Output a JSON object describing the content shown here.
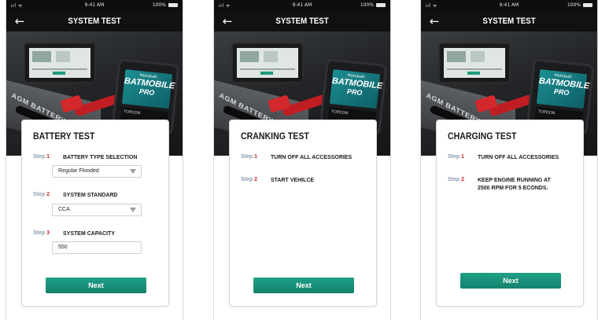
{
  "status_bar": {
    "signal": "ııl ᯤ",
    "time": "9:41 AM",
    "battery": "100%"
  },
  "nav": {
    "title": "SYSTEM TEST",
    "back_icon": "arrow-left-icon"
  },
  "hero": {
    "battery_label": "AGM BATTERY",
    "tester_brand": "Motobatt",
    "tester_model": "BATMOBILE",
    "tester_sub": "PRO",
    "tester_code": "TOPDON"
  },
  "screens": [
    {
      "card_title": "BATTERY TEST",
      "steps": [
        {
          "label": "Step",
          "num": "1",
          "text": "BATTERY TYPE SELECTION",
          "field": "Regular Flooded",
          "has_dropdown": true
        },
        {
          "label": "Step",
          "num": "2",
          "text": "SYSTEM STANDARD",
          "field": "CCA",
          "has_dropdown": true
        },
        {
          "label": "Step",
          "num": "3",
          "text": "SYSTEM CAPACITY",
          "field": "550",
          "has_dropdown": false
        }
      ],
      "next_label": "Next"
    },
    {
      "card_title": "CRANKING TEST",
      "steps": [
        {
          "label": "Step",
          "num": "1",
          "text": "TURN OFF ALL ACCESSORIES"
        },
        {
          "label": "Step",
          "num": "2",
          "text": "START VEHILCE"
        }
      ],
      "next_label": "Next"
    },
    {
      "card_title": "CHARGING TEST",
      "steps": [
        {
          "label": "Step",
          "num": "1",
          "text": "TURN OFF ALL ACCESSORIES"
        },
        {
          "label": "Step",
          "num": "2",
          "text": "KEEP ENGINE RUNNING AT 2500 RPM FOR 5 ECONDS."
        }
      ],
      "next_label": "Next"
    }
  ],
  "colors": {
    "accent": "#1a9a80",
    "step_number": "#cc2a2a",
    "step_label": "#8a9bb1",
    "nav_bg": "#111111"
  }
}
